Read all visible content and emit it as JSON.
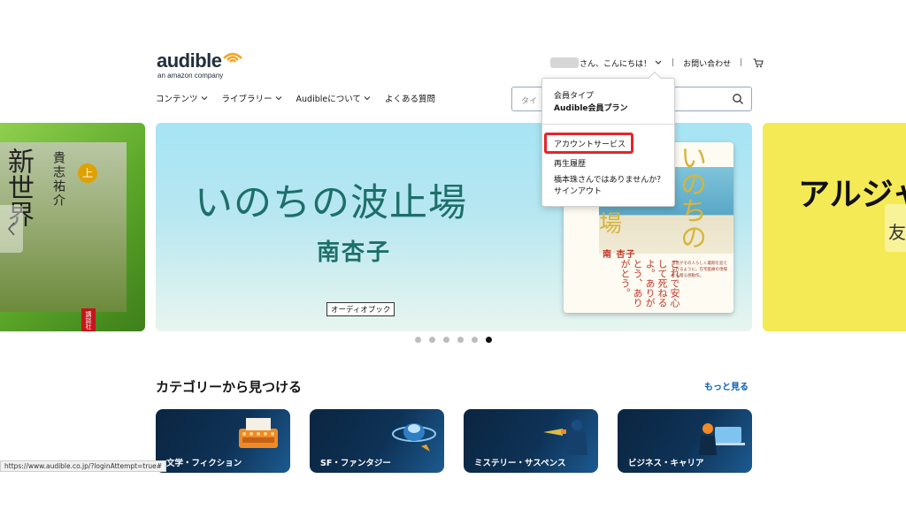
{
  "logo": {
    "word": "audible",
    "tagline": "an amazon company"
  },
  "header": {
    "greeting": "さん、こんにちは！",
    "contact": "お問い合わせ"
  },
  "nav": {
    "items": [
      {
        "label": "コンテンツ",
        "has_dropdown": true
      },
      {
        "label": "ライブラリー",
        "has_dropdown": true
      },
      {
        "label": "Audibleについて",
        "has_dropdown": true
      },
      {
        "label": "よくある質問",
        "has_dropdown": false
      }
    ]
  },
  "search": {
    "placeholder": "タイ"
  },
  "account_menu": {
    "type_label": "会員タイプ",
    "plan": "Audible会員プラン",
    "account_service": "アカウントサービス",
    "history": "再生履歴",
    "not_me": "橋本珠さんではありませんか？",
    "sign_out": "サインアウト"
  },
  "carousel": {
    "left": {
      "title": "新世界",
      "author": "貴志祐介",
      "volume": "上",
      "stamp": "講談社"
    },
    "main": {
      "title": "いのちの波止場",
      "author": "南杏子",
      "badge": "オーディオブック",
      "cover_title": "いのちの",
      "cover_title2": "場",
      "cover_author": "南 杏子",
      "cover_copy": "これで安心して死ねるよ。ありがとう、ありがとう。",
      "cover_blurb": "患者がその人らしく最期を迎えられるように。在宅医療の現場から贈る感動作。"
    },
    "right": {
      "title": "アルジャ",
      "sub": "友"
    },
    "dots": 6,
    "active_dot": 5
  },
  "categories": {
    "title": "カテゴリーから見つける",
    "more": "もっと見る",
    "items": [
      {
        "label": "文学・フィクション",
        "icon": "typewriter-icon"
      },
      {
        "label": "SF・ファンタジー",
        "icon": "ufo-icon"
      },
      {
        "label": "ミステリー・サスペンス",
        "icon": "detective-icon"
      },
      {
        "label": "ビジネス・キャリア",
        "icon": "laptop-person-icon"
      }
    ]
  },
  "status_bar": {
    "url": "https://www.audible.co.jp/?loginAttempt=true#"
  },
  "colors": {
    "accent": "#e5252a",
    "link": "#0a5fb4",
    "logo_orange": "#f7a31c",
    "title_teal": "#1d6f69"
  }
}
